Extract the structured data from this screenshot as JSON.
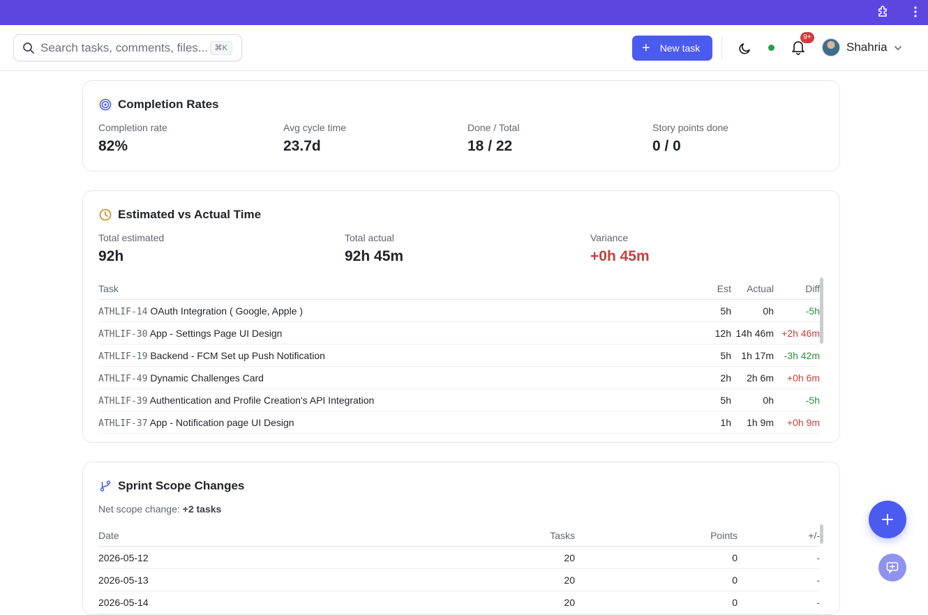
{
  "header": {
    "search_placeholder": "Search tasks, comments, files...",
    "search_shortcut": "⌘K",
    "new_task_label": "New task",
    "notifications_badge": "9+",
    "user_name": "Shahria"
  },
  "completion": {
    "title": "Completion Rates",
    "stats": [
      {
        "label": "Completion rate",
        "value": "82%"
      },
      {
        "label": "Avg cycle time",
        "value": "23.7d"
      },
      {
        "label": "Done / Total",
        "value": "18 / 22"
      },
      {
        "label": "Story points done",
        "value": "0 / 0"
      }
    ]
  },
  "time": {
    "title": "Estimated vs Actual Time",
    "stats": [
      {
        "label": "Total estimated",
        "value": "92h"
      },
      {
        "label": "Total actual",
        "value": "92h 45m"
      },
      {
        "label": "Variance",
        "value": "+0h 45m"
      }
    ],
    "columns": {
      "task": "Task",
      "est": "Est",
      "actual": "Actual",
      "diff": "Diff"
    },
    "rows": [
      {
        "key": "ATHLIF-14",
        "name": "OAuth Integration ( Google, Apple )",
        "est": "5h",
        "actual": "0h",
        "diff": "-5h",
        "tone": "green"
      },
      {
        "key": "ATHLIF-30",
        "name": "App - Settings Page UI Design",
        "est": "12h",
        "actual": "14h 46m",
        "diff": "+2h 46m",
        "tone": "red"
      },
      {
        "key": "ATHLIF-19",
        "name": "Backend - FCM Set up Push Notification",
        "est": "5h",
        "actual": "1h 17m",
        "diff": "-3h 42m",
        "tone": "green"
      },
      {
        "key": "ATHLIF-49",
        "name": "Dynamic Challenges Card",
        "est": "2h",
        "actual": "2h 6m",
        "diff": "+0h 6m",
        "tone": "red"
      },
      {
        "key": "ATHLIF-39",
        "name": "Authentication and Profile Creation's API Integration",
        "est": "5h",
        "actual": "0h",
        "diff": "-5h",
        "tone": "green"
      },
      {
        "key": "ATHLIF-37",
        "name": "App - Notification page UI Design",
        "est": "1h",
        "actual": "1h 9m",
        "diff": "+0h 9m",
        "tone": "red"
      }
    ]
  },
  "scope": {
    "title": "Sprint Scope Changes",
    "net_label": "Net scope change:",
    "net_value": "+2 tasks",
    "columns": {
      "date": "Date",
      "tasks": "Tasks",
      "points": "Points",
      "delta": "+/-"
    },
    "rows": [
      {
        "date": "2026-05-12",
        "tasks": "20",
        "points": "0",
        "delta": "-"
      },
      {
        "date": "2026-05-13",
        "tasks": "20",
        "points": "0",
        "delta": "-"
      },
      {
        "date": "2026-05-14",
        "tasks": "20",
        "points": "0",
        "delta": "-"
      }
    ]
  },
  "colors": {
    "accent": "#4b5bf0",
    "topbar": "#5b47e0",
    "positive": "#2e8b3a",
    "negative": "#c2413b"
  }
}
